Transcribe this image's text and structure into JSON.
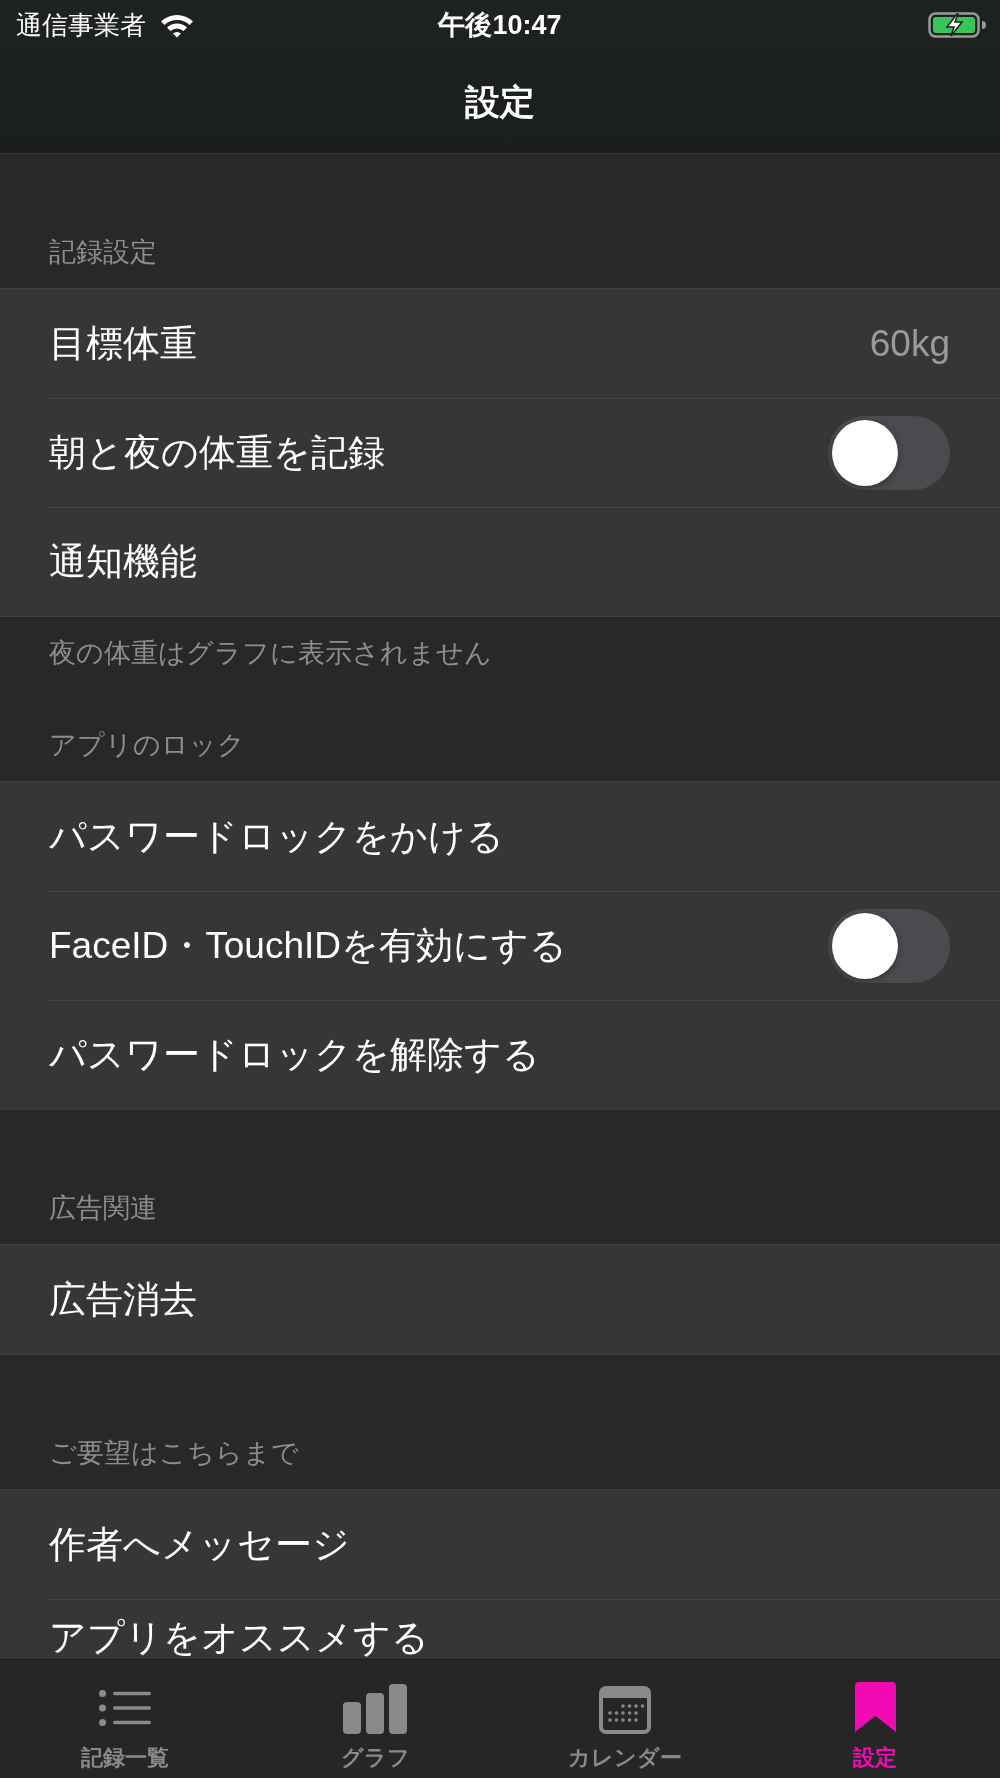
{
  "status_bar": {
    "carrier": "通信事業者",
    "time": "午後10:47",
    "charging": true
  },
  "nav_bar": {
    "title": "設定"
  },
  "sections": [
    {
      "header": "記録設定",
      "rows": [
        {
          "kind": "value",
          "label": "目標体重",
          "value": "60kg"
        },
        {
          "kind": "toggle",
          "label": "朝と夜の体重を記録",
          "on": false
        },
        {
          "kind": "plain",
          "label": "通知機能"
        }
      ],
      "footer": "夜の体重はグラフに表示されません"
    },
    {
      "header": "アプリのロック",
      "rows": [
        {
          "kind": "plain",
          "label": "パスワードロックをかける"
        },
        {
          "kind": "toggle",
          "label": "FaceID・TouchIDを有効にする",
          "on": false
        },
        {
          "kind": "plain",
          "label": "パスワードロックを解除する"
        }
      ]
    },
    {
      "header": "広告関連",
      "rows": [
        {
          "kind": "plain",
          "label": "広告消去"
        }
      ]
    },
    {
      "header": "ご要望はこちらまで",
      "rows": [
        {
          "kind": "plain",
          "label": "作者へメッセージ"
        },
        {
          "kind": "plain",
          "label": "アプリをオススメする"
        }
      ]
    }
  ],
  "tab_bar": [
    {
      "kind": "list",
      "label": "記録一覧",
      "selected": false
    },
    {
      "kind": "bars",
      "label": "グラフ",
      "selected": false
    },
    {
      "kind": "calendar",
      "label": "カレンダー",
      "selected": false
    },
    {
      "kind": "bookmark",
      "label": "設定",
      "selected": true
    }
  ]
}
